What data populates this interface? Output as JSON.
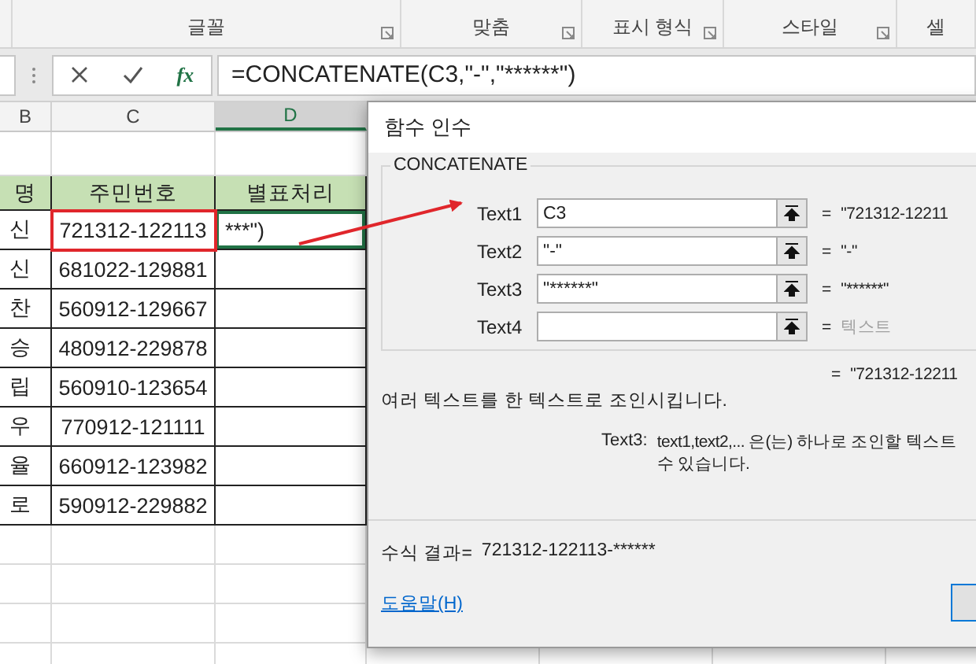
{
  "ribbon": {
    "groups": [
      "글꼴",
      "맞춤",
      "표시 형식",
      "스타일",
      "셀"
    ]
  },
  "formula_bar": {
    "function_button": "fx",
    "formula": "=CONCATENATE(C3,\"-\",\"******\")"
  },
  "column_headers": [
    {
      "label": "B",
      "selected": false
    },
    {
      "label": "C",
      "selected": false
    },
    {
      "label": "D",
      "selected": true
    }
  ],
  "sheet": {
    "headers": [
      "명",
      "주민번호",
      "별표처리"
    ],
    "rows": [
      {
        "cells": [
          "신",
          "721312-122113",
          "***\")"
        ],
        "marked": true,
        "active": true
      },
      {
        "cells": [
          "신",
          "681022-129881"
        ],
        "marked": false,
        "active": false
      },
      {
        "cells": [
          "찬",
          "560912-129667"
        ],
        "marked": false,
        "active": false
      },
      {
        "cells": [
          "승",
          "480912-229878"
        ],
        "marked": false,
        "active": false
      },
      {
        "cells": [
          "립",
          "560910-123654"
        ],
        "marked": false,
        "active": false
      },
      {
        "cells": [
          "우",
          "770912-121111"
        ],
        "marked": false,
        "active": false
      },
      {
        "cells": [
          "율",
          "660912-123982"
        ],
        "marked": false,
        "active": false
      },
      {
        "cells": [
          "로",
          "590912-229882"
        ],
        "marked": false,
        "active": false
      }
    ]
  },
  "dialog": {
    "title": "함수 인수",
    "function": "CONCATENATE",
    "arguments": [
      {
        "label": "Text1",
        "value": "C3",
        "equals": "=",
        "result": "\"721312-12211",
        "greyed": false
      },
      {
        "label": "Text2",
        "value": "\"-\"",
        "equals": "=",
        "result": "\"-\"",
        "greyed": false
      },
      {
        "label": "Text3",
        "value": "\"******\"",
        "equals": "=",
        "result": "\"******\"",
        "greyed": false
      },
      {
        "label": "Text4",
        "equals": "=",
        "result": "텍스트",
        "greyed": true
      }
    ],
    "total_equals": "=",
    "total_result": "\"721312-12211",
    "description": "여러 텍스트를 한 텍스트로 조인시킵니다.",
    "arg_help": {
      "name": "Text3:",
      "lines": [
        "text1,text2,... 은(는) 하나로 조인할 텍스트",
        "수 있습니다."
      ]
    },
    "formula_result_label": "수식 결과=",
    "formula_result": "721312-122113-******",
    "help_link": "도움말(H)"
  }
}
